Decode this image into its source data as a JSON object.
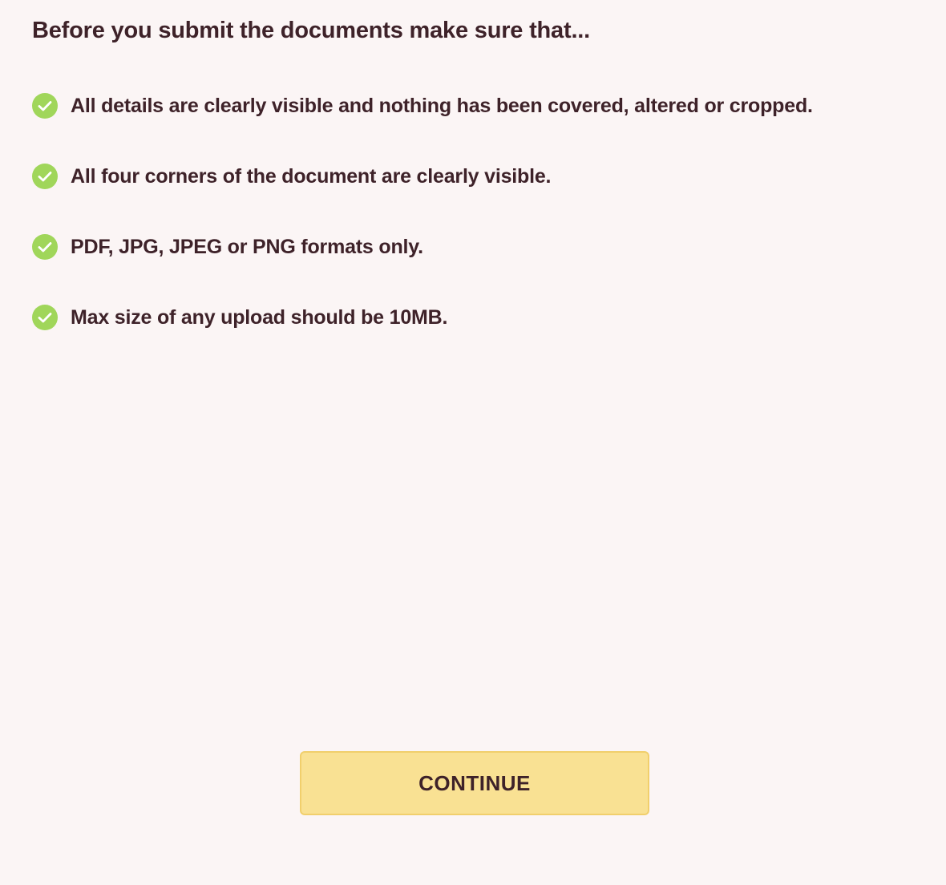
{
  "heading": "Before you submit the documents make sure that...",
  "checklist": [
    {
      "text": "All details are clearly visible and nothing has been covered, altered or cropped.",
      "icon": "check-circle-icon"
    },
    {
      "text": "All four corners of the document are clearly visible.",
      "icon": "check-circle-icon"
    },
    {
      "text": "PDF, JPG, JPEG or PNG formats only.",
      "icon": "check-circle-icon"
    },
    {
      "text": "Max size of any upload should be 10MB.",
      "icon": "check-circle-icon"
    }
  ],
  "continue_button": {
    "label": "CONTINUE"
  },
  "colors": {
    "background": "#fbf5f5",
    "text": "#3e2229",
    "check": "#a0d65a",
    "button_fill": "#f9e193",
    "button_border": "#f1cf6c"
  }
}
